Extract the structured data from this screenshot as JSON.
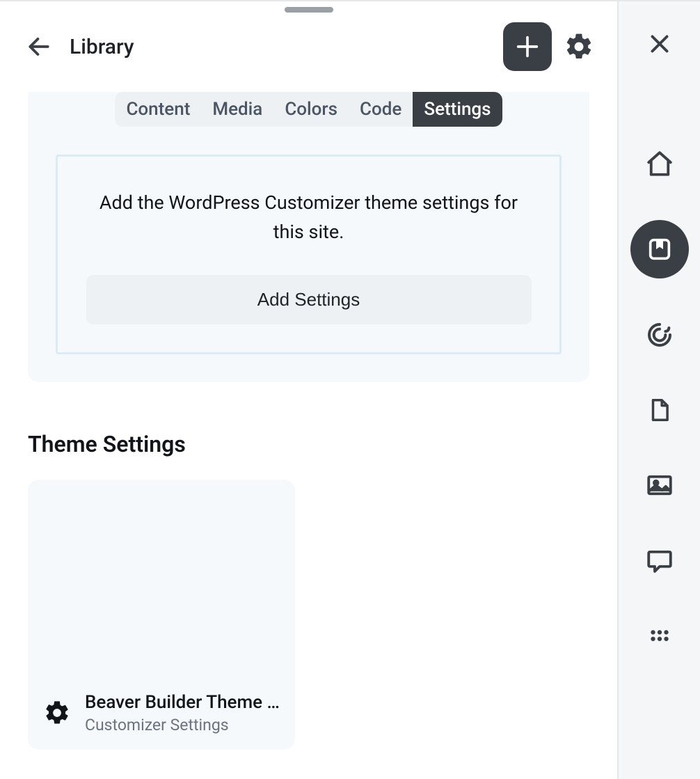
{
  "header": {
    "title": "Library"
  },
  "tabs": {
    "items": [
      {
        "label": "Content",
        "active": false
      },
      {
        "label": "Media",
        "active": false
      },
      {
        "label": "Colors",
        "active": false
      },
      {
        "label": "Code",
        "active": false
      },
      {
        "label": "Settings",
        "active": true
      }
    ]
  },
  "settings_panel": {
    "description": "Add the WordPress Customizer theme settings for this site.",
    "add_button_label": "Add Settings"
  },
  "theme_settings": {
    "heading": "Theme Settings",
    "items": [
      {
        "title": "Beaver Builder Theme …",
        "subtitle": "Customizer Settings",
        "icon": "gear-icon"
      }
    ]
  },
  "rail": {
    "items": [
      {
        "name": "close",
        "icon": "close-icon"
      },
      {
        "name": "home",
        "icon": "home-icon"
      },
      {
        "name": "library",
        "icon": "bookmark-square-icon",
        "active": true
      },
      {
        "name": "sync",
        "icon": "swirl-icon"
      },
      {
        "name": "document",
        "icon": "file-icon"
      },
      {
        "name": "media",
        "icon": "image-icon"
      },
      {
        "name": "chat",
        "icon": "chat-icon"
      },
      {
        "name": "more",
        "icon": "grid-dots-icon"
      }
    ]
  }
}
